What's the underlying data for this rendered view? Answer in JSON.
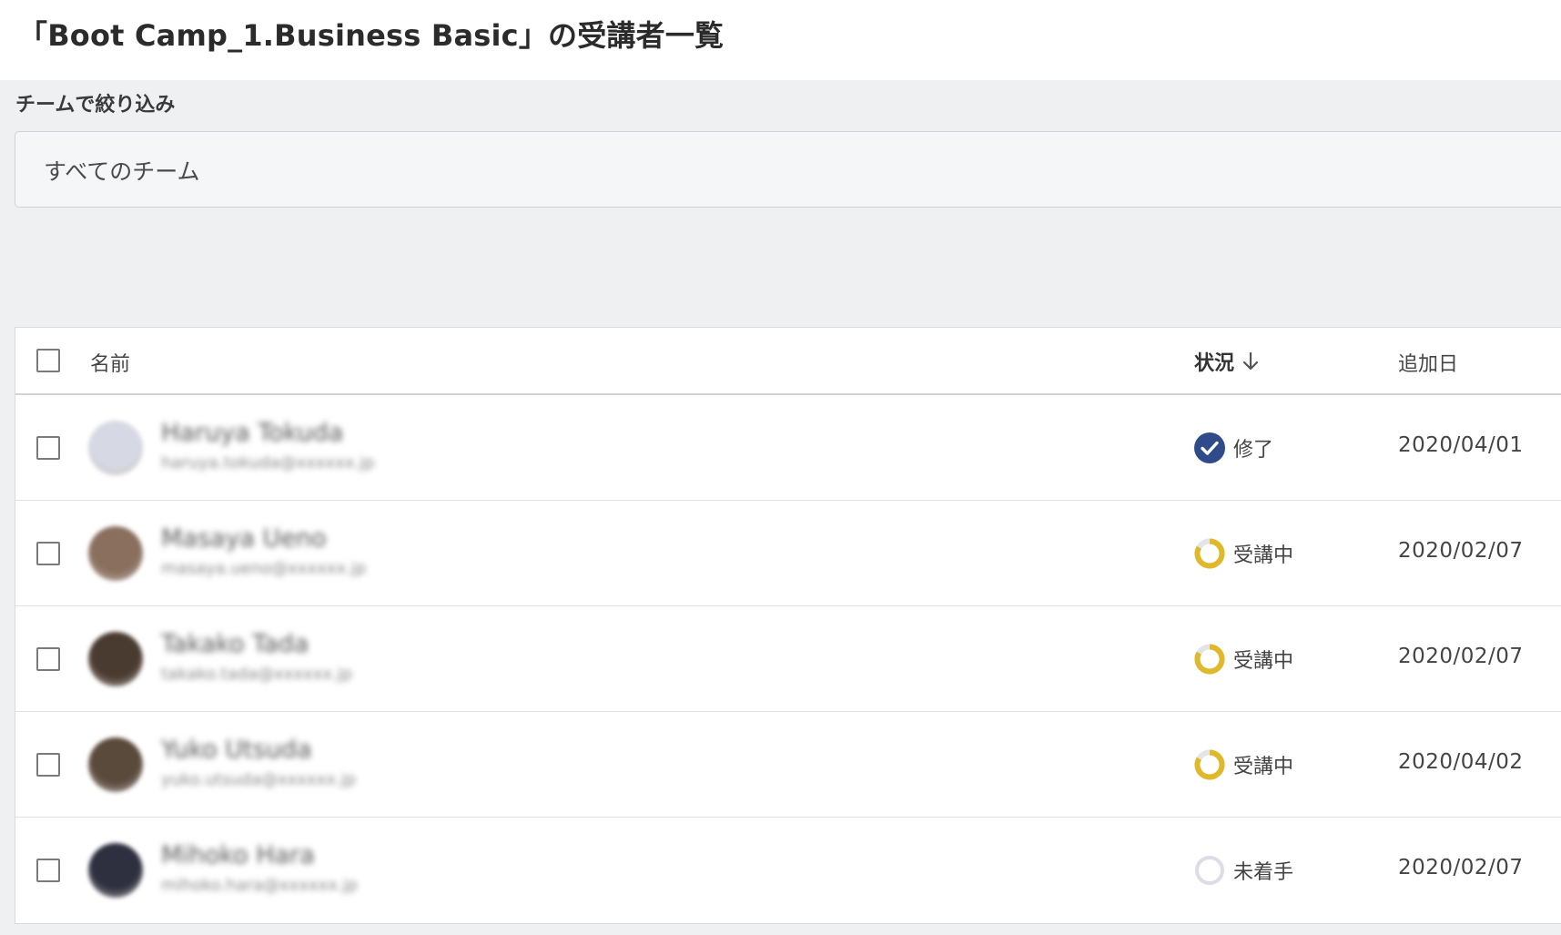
{
  "page": {
    "title": "「Boot Camp_1.Business Basic」の受講者一覧"
  },
  "filter": {
    "label": "チームで絞り込み",
    "selected_team": "すべてのチーム"
  },
  "table": {
    "columns": {
      "name": "名前",
      "status": "状況",
      "added_date": "追加日"
    },
    "rows": [
      {
        "name": "Haruya Tokuda",
        "email": "haruya.tokuda@xxxxxx.jp",
        "status": "修了",
        "status_type": "completed",
        "status_icon": "check-circle-icon",
        "added_date": "2020/04/01",
        "avatar_color": "#d6d9e4"
      },
      {
        "name": "Masaya Ueno",
        "email": "masaya.ueno@xxxxxx.jp",
        "status": "受講中",
        "status_type": "in-progress",
        "status_icon": "progress-ring-icon",
        "added_date": "2020/02/07",
        "avatar_color": "#8a6f5e"
      },
      {
        "name": "Takako Tada",
        "email": "takako.tada@xxxxxx.jp",
        "status": "受講中",
        "status_type": "in-progress",
        "status_icon": "progress-ring-icon",
        "added_date": "2020/02/07",
        "avatar_color": "#4a3b30"
      },
      {
        "name": "Yuko Utsuda",
        "email": "yuko.utsuda@xxxxxx.jp",
        "status": "受講中",
        "status_type": "in-progress",
        "status_icon": "progress-ring-icon",
        "added_date": "2020/04/02",
        "avatar_color": "#5a4a3c"
      },
      {
        "name": "Mihoko Hara",
        "email": "mihoko.hara@xxxxxx.jp",
        "status": "未着手",
        "status_type": "not-started",
        "status_icon": "empty-ring-icon",
        "added_date": "2020/02/07",
        "avatar_color": "#2e3040"
      }
    ]
  },
  "colors": {
    "completed": "#2f4b8a",
    "in_progress": "#e0b92a",
    "ring_track": "#e3e4e8",
    "not_started": "#dcdde6"
  }
}
